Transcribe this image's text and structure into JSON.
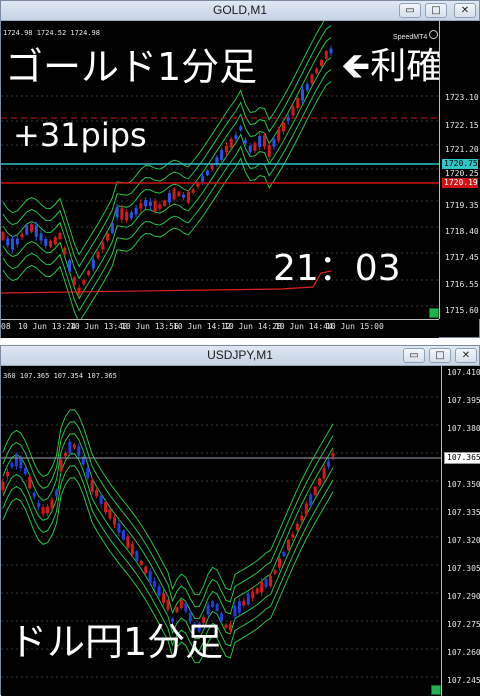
{
  "top_window": {
    "title": "GOLD,M1",
    "ohlc": "1724.98 1724.52 1724.98",
    "badge": "SpeedMT4",
    "price_labels": [
      "1723.10",
      "1722.15",
      "1721.20",
      "1720.25",
      "1719.35",
      "1718.40",
      "1717.45",
      "1716.55",
      "1715.60"
    ],
    "price_tags": {
      "cyan": "1720.75",
      "red": "1720.19"
    },
    "time_labels": [
      "08",
      "10 Jun 13:24",
      "10 Jun 13:40",
      "10 Jun 13:56",
      "10 Jun 14:12",
      "10 Jun 14:28",
      "10 Jun 14:44",
      "10 Jun 15:00"
    ],
    "overlay": {
      "headline": "ゴールド1分足",
      "arrow_note": "🡸利確",
      "profit": "+31pips",
      "clock": "21：03"
    },
    "colors": {
      "cyan_line": "#2fc6c6",
      "red_line": "#cc1414",
      "band": "#27c04a"
    }
  },
  "bottom_window": {
    "title": "USDJPY,M1",
    "ohlc": "360 107.365 107.354 107.365",
    "price_labels": [
      "107.410",
      "107.395",
      "107.380",
      "107.365",
      "107.350",
      "107.335",
      "107.320",
      "107.305",
      "107.290",
      "107.275",
      "107.260",
      "107.245"
    ],
    "overlay": {
      "headline": "ドル円1分足"
    },
    "colors": {
      "band": "#27c04a",
      "bull": "#d61a1a",
      "bear": "#2040e0"
    }
  },
  "window_controls": {
    "minimize": "▭",
    "maximize": "□",
    "close": "✕"
  }
}
